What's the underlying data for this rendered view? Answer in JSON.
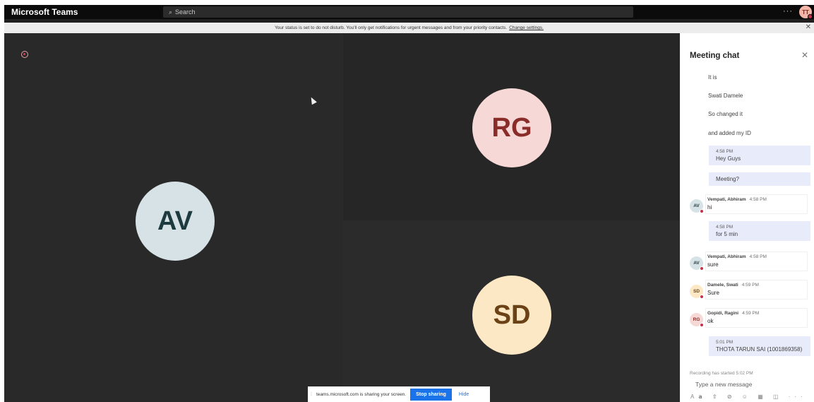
{
  "app": {
    "title": "Microsoft Teams",
    "search_placeholder": "Search",
    "more_label": "···",
    "user_initials": "TT"
  },
  "banner": {
    "text": "Your status is set to do not disturb. You'll only get notifications for urgent messages and from your priority contacts.",
    "link": "Change settings.",
    "close": "✕"
  },
  "stage": {
    "tiles": [
      {
        "initials": "AV",
        "bg": "#d6e2e5",
        "fg": "#1d3a3f"
      },
      {
        "initials": "RG",
        "bg": "#f6d8d6",
        "fg": "#8a2d2a"
      },
      {
        "initials": "SD",
        "bg": "#fce8c4",
        "fg": "#6b4216"
      }
    ]
  },
  "share": {
    "grip": "⁞",
    "text": "teams.microsoft.com is sharing your screen.",
    "stop": "Stop sharing",
    "hide": "Hide"
  },
  "chat": {
    "title": "Meeting chat",
    "close": "✕",
    "plain_messages": [
      "It is",
      "Swati Damele",
      "So changed it",
      "and added my ID"
    ],
    "own": [
      {
        "time": "4:58 PM",
        "text": "Hey Guys"
      },
      {
        "time": "",
        "text": "Meeting?"
      },
      {
        "time": "4:58 PM",
        "text": "for 5 min"
      },
      {
        "time": "5:01 PM",
        "text": "THOTA TARUN SAI (1001869358)"
      }
    ],
    "others": [
      {
        "initials": "AV",
        "name": "Vempati, Abhiram",
        "time": "4:58 PM",
        "text": "hi",
        "bg": "#d6e2e5",
        "fg": "#1d3a3f"
      },
      {
        "initials": "AV",
        "name": "Vempati, Abhiram",
        "time": "4:58 PM",
        "text": "sure",
        "bg": "#d6e2e5",
        "fg": "#1d3a3f"
      },
      {
        "initials": "SD",
        "name": "Damele, Swati",
        "time": "4:59 PM",
        "text": "Sure",
        "bg": "#fce8c4",
        "fg": "#6b4216"
      },
      {
        "initials": "RG",
        "name": "Gopidi, Ragini",
        "time": "4:59 PM",
        "text": "ok",
        "bg": "#f6d8d6",
        "fg": "#8a2d2a"
      }
    ],
    "system_text": "Recording has started   5:02 PM",
    "compose_placeholder": "Type a new message",
    "tools": "A𝗮 ⇧ ⊘ ☺ ▦ ◫ ···"
  },
  "colors": {
    "accent": "#1a73e8",
    "dnd": "#c4314b",
    "own_bubble": "#e8ebfa"
  }
}
